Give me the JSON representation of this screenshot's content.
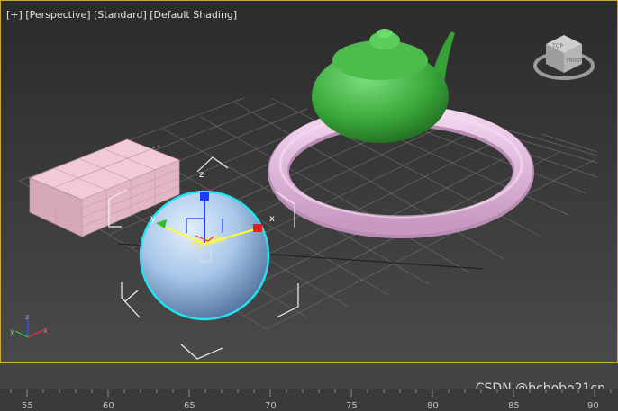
{
  "viewport": {
    "plus_label": "[+]",
    "view_label": "[Perspective]",
    "mode_label": "[Standard]",
    "shading_label": "[Default Shading]"
  },
  "gizmo": {
    "x_label": "x",
    "y_label": "y",
    "z_label": "z"
  },
  "axis_tripod": {
    "x_label": "x",
    "y_label": "y",
    "z_label": "z"
  },
  "viewcube": {
    "label": "TOP",
    "front_label": "FRONT"
  },
  "timeline": {
    "ticks": [
      "55",
      "60",
      "65",
      "70",
      "75",
      "80",
      "85",
      "90"
    ]
  },
  "watermark": "CSDN @bcbobo21cn",
  "colors": {
    "teapot": "#3aa63a",
    "torus": "#e2b8dc",
    "box": "#e8bfcf",
    "sphere": "#a9c7ea",
    "selection": "#22e3f0",
    "viewport_border": "#c8a93a"
  }
}
